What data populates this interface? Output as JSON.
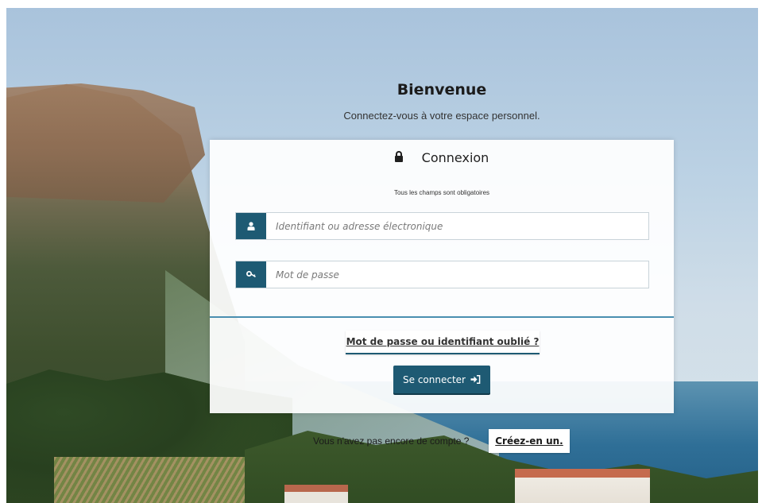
{
  "header": {
    "title": "Bienvenue",
    "subtitle": "Connectez-vous à votre espace personnel."
  },
  "login_card": {
    "title": "Connexion",
    "title_icon": "lock-icon",
    "required_note": "Tous les champs sont obligatoires",
    "username": {
      "icon": "user-icon",
      "placeholder": "Identifiant ou adresse électronique",
      "value": ""
    },
    "password": {
      "icon": "key-icon",
      "placeholder": "Mot de passe",
      "value": ""
    },
    "forgot_link": "Mot de passe ou identifiant oublié ?",
    "submit": {
      "label": "Se connecter",
      "icon": "sign-in-icon"
    }
  },
  "footer": {
    "no_account_text": "Vous n'avez pas encore de compte ?",
    "create_link": "Créez-en un."
  },
  "colors": {
    "accent": "#1e5a73",
    "divider": "#4a8fb0"
  }
}
